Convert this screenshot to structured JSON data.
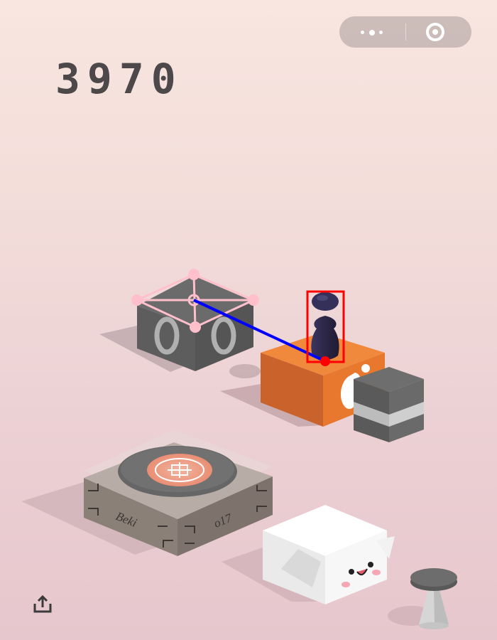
{
  "score": "3970",
  "top_capsule": {
    "menu_icon": "more-dots-icon",
    "close_icon": "target-circle-icon"
  },
  "blocks": [
    {
      "name": "gray-target-box",
      "decoration": "ring-icon"
    },
    {
      "name": "orange-box",
      "decoration": "white-blob"
    },
    {
      "name": "gray-striped-box"
    },
    {
      "name": "record-player-box",
      "engraving_left": "Beki",
      "engraving_right": "o17"
    },
    {
      "name": "smiling-white-box"
    },
    {
      "name": "gray-stool"
    }
  ],
  "player": {
    "name": "chess-piece-player",
    "color": "#2f2a4a"
  },
  "overlays": {
    "jump_line_color": "#0000ff",
    "player_box_color": "#ff0000",
    "target_outline_color": "#ffc0cb"
  },
  "colors": {
    "orange": "#e8782e",
    "gray": "#6b6b6b",
    "score": "#4d4849"
  },
  "share_icon": "share-upload-icon"
}
